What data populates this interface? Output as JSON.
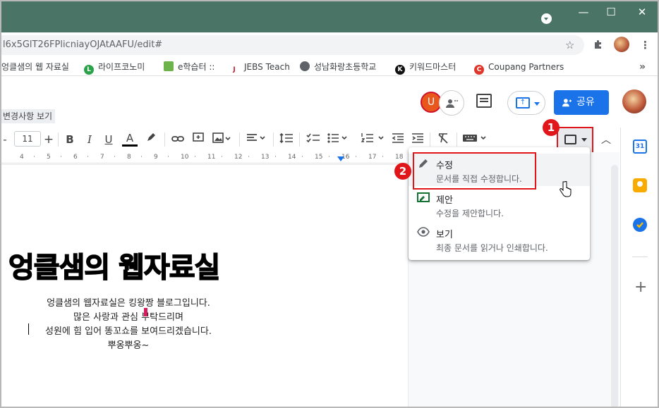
{
  "browser": {
    "url": "l6x5GlT26FPlicniayOJAtAAFU/edit#",
    "window_controls": {
      "minimize": "—",
      "maximize": "☐",
      "close": "✕"
    }
  },
  "bookmarks": [
    {
      "label": "엉클샘의 웹 자료실",
      "icon_color": "#ffffff"
    },
    {
      "label": "라이프코노미",
      "icon_color": "#2aa24a",
      "icon_text": "L"
    },
    {
      "label": "e학습터 ::",
      "icon_color": "#6bb34a"
    },
    {
      "label": "JEBS Teach",
      "icon_color": "#c02030"
    },
    {
      "label": "성남화랑초등학교",
      "icon_color": "#5f6368"
    },
    {
      "label": "키워드마스터",
      "icon_color": "#111111",
      "icon_text": "K"
    },
    {
      "label": "Coupang Partners",
      "icon_color": "#e0352b",
      "icon_text": "C"
    }
  ],
  "docs_header": {
    "changes_link": "변경사항 보기",
    "avatar_letter": "U",
    "share_label": "공유"
  },
  "toolbar": {
    "font_size": "11",
    "minus": "-",
    "plus": "+",
    "bold": "B",
    "italic": "I",
    "underline": "U",
    "text_color": "A"
  },
  "ruler": [
    "4",
    "5",
    "6",
    "7",
    "8",
    "9",
    "10",
    "11",
    "12",
    "13",
    "14",
    "15",
    "16",
    "17",
    "18"
  ],
  "document": {
    "title": "엉클샘의 웹자료실",
    "lines": [
      "엉클샘의 웹자료실은 킹왕짱 블로그입니다.",
      "많은 사랑과 관심 부탁드리며",
      "성원에 힘 입어 똥꼬쇼를 보여드리겠습니다.",
      "뿌옹뿌옹~"
    ]
  },
  "mode_menu": {
    "items": [
      {
        "title": "수정",
        "desc": "문서를 직접 수정합니다.",
        "icon": "pencil-icon"
      },
      {
        "title": "제안",
        "desc": "수정을 제안합니다.",
        "icon": "suggest-icon"
      },
      {
        "title": "보기",
        "desc": "최종 문서를 읽거나 인쇄합니다.",
        "icon": "eye-icon"
      }
    ]
  },
  "annotations": {
    "step1": "1",
    "step2": "2"
  },
  "colors": {
    "titlebar": "#4a7566",
    "share": "#1a73e8",
    "highlight": "#e0161a"
  }
}
